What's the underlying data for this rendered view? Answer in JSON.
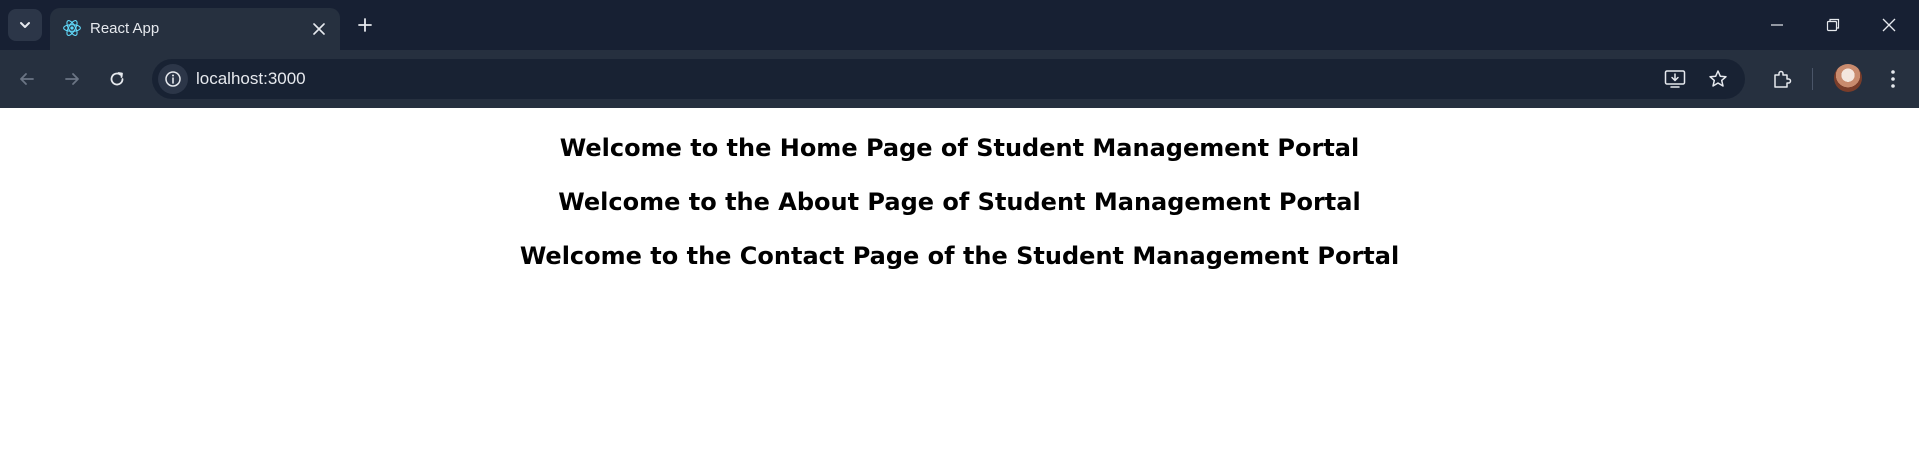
{
  "browser": {
    "tab": {
      "title": "React App",
      "favicon": "react-icon"
    },
    "address_bar": {
      "url": "localhost:3000"
    },
    "colors": {
      "tabbar_bg": "#172033",
      "toolbar_bg": "#26303f",
      "omnibox_bg": "#182233",
      "react_accent": "#61dafb"
    }
  },
  "page": {
    "headings": [
      "Welcome to the Home Page of Student Management Portal",
      "Welcome to the About Page of Student Management Portal",
      "Welcome to the Contact Page of the Student Management Portal"
    ]
  }
}
